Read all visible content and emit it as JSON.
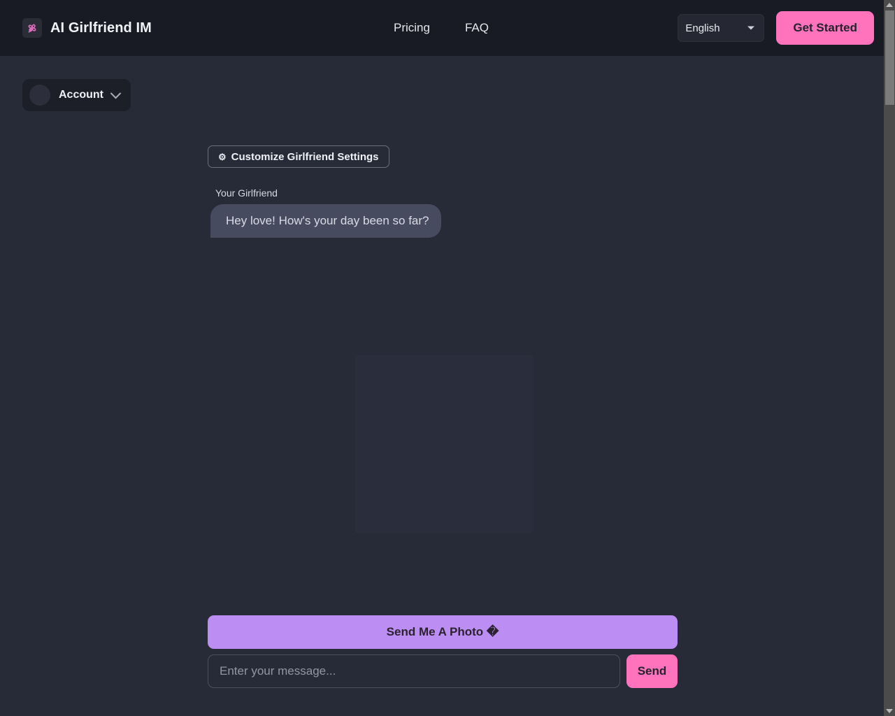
{
  "header": {
    "brand_title": "AI Girlfriend IM",
    "logo_icon": "clover-logo-icon",
    "nav": [
      {
        "label": "Pricing",
        "name": "nav-link-pricing"
      },
      {
        "label": "FAQ",
        "name": "nav-link-faq"
      }
    ],
    "language": {
      "selected": "English",
      "options": [
        "English"
      ]
    },
    "get_started_label": "Get Started"
  },
  "account": {
    "label": "Account",
    "avatar_icon": "user-avatar-placeholder",
    "chevron_icon": "chevron-down-icon"
  },
  "chat": {
    "customize_label": "Customize Girlfriend Settings",
    "customize_icon": "gear-icon",
    "messages": [
      {
        "sender": "Your Girlfriend",
        "text": "Hey love! How's your day been so far?"
      }
    ]
  },
  "composer": {
    "photo_button_label": "Send Me A Photo �",
    "input_placeholder": "Enter your message...",
    "input_value": "",
    "send_label": "Send"
  },
  "colors": {
    "page_bg": "#272b38",
    "header_bg": "#191b24",
    "accent_pink": "#ff73bd",
    "accent_purple": "#bc8df2",
    "bubble_bg": "#464b60"
  }
}
